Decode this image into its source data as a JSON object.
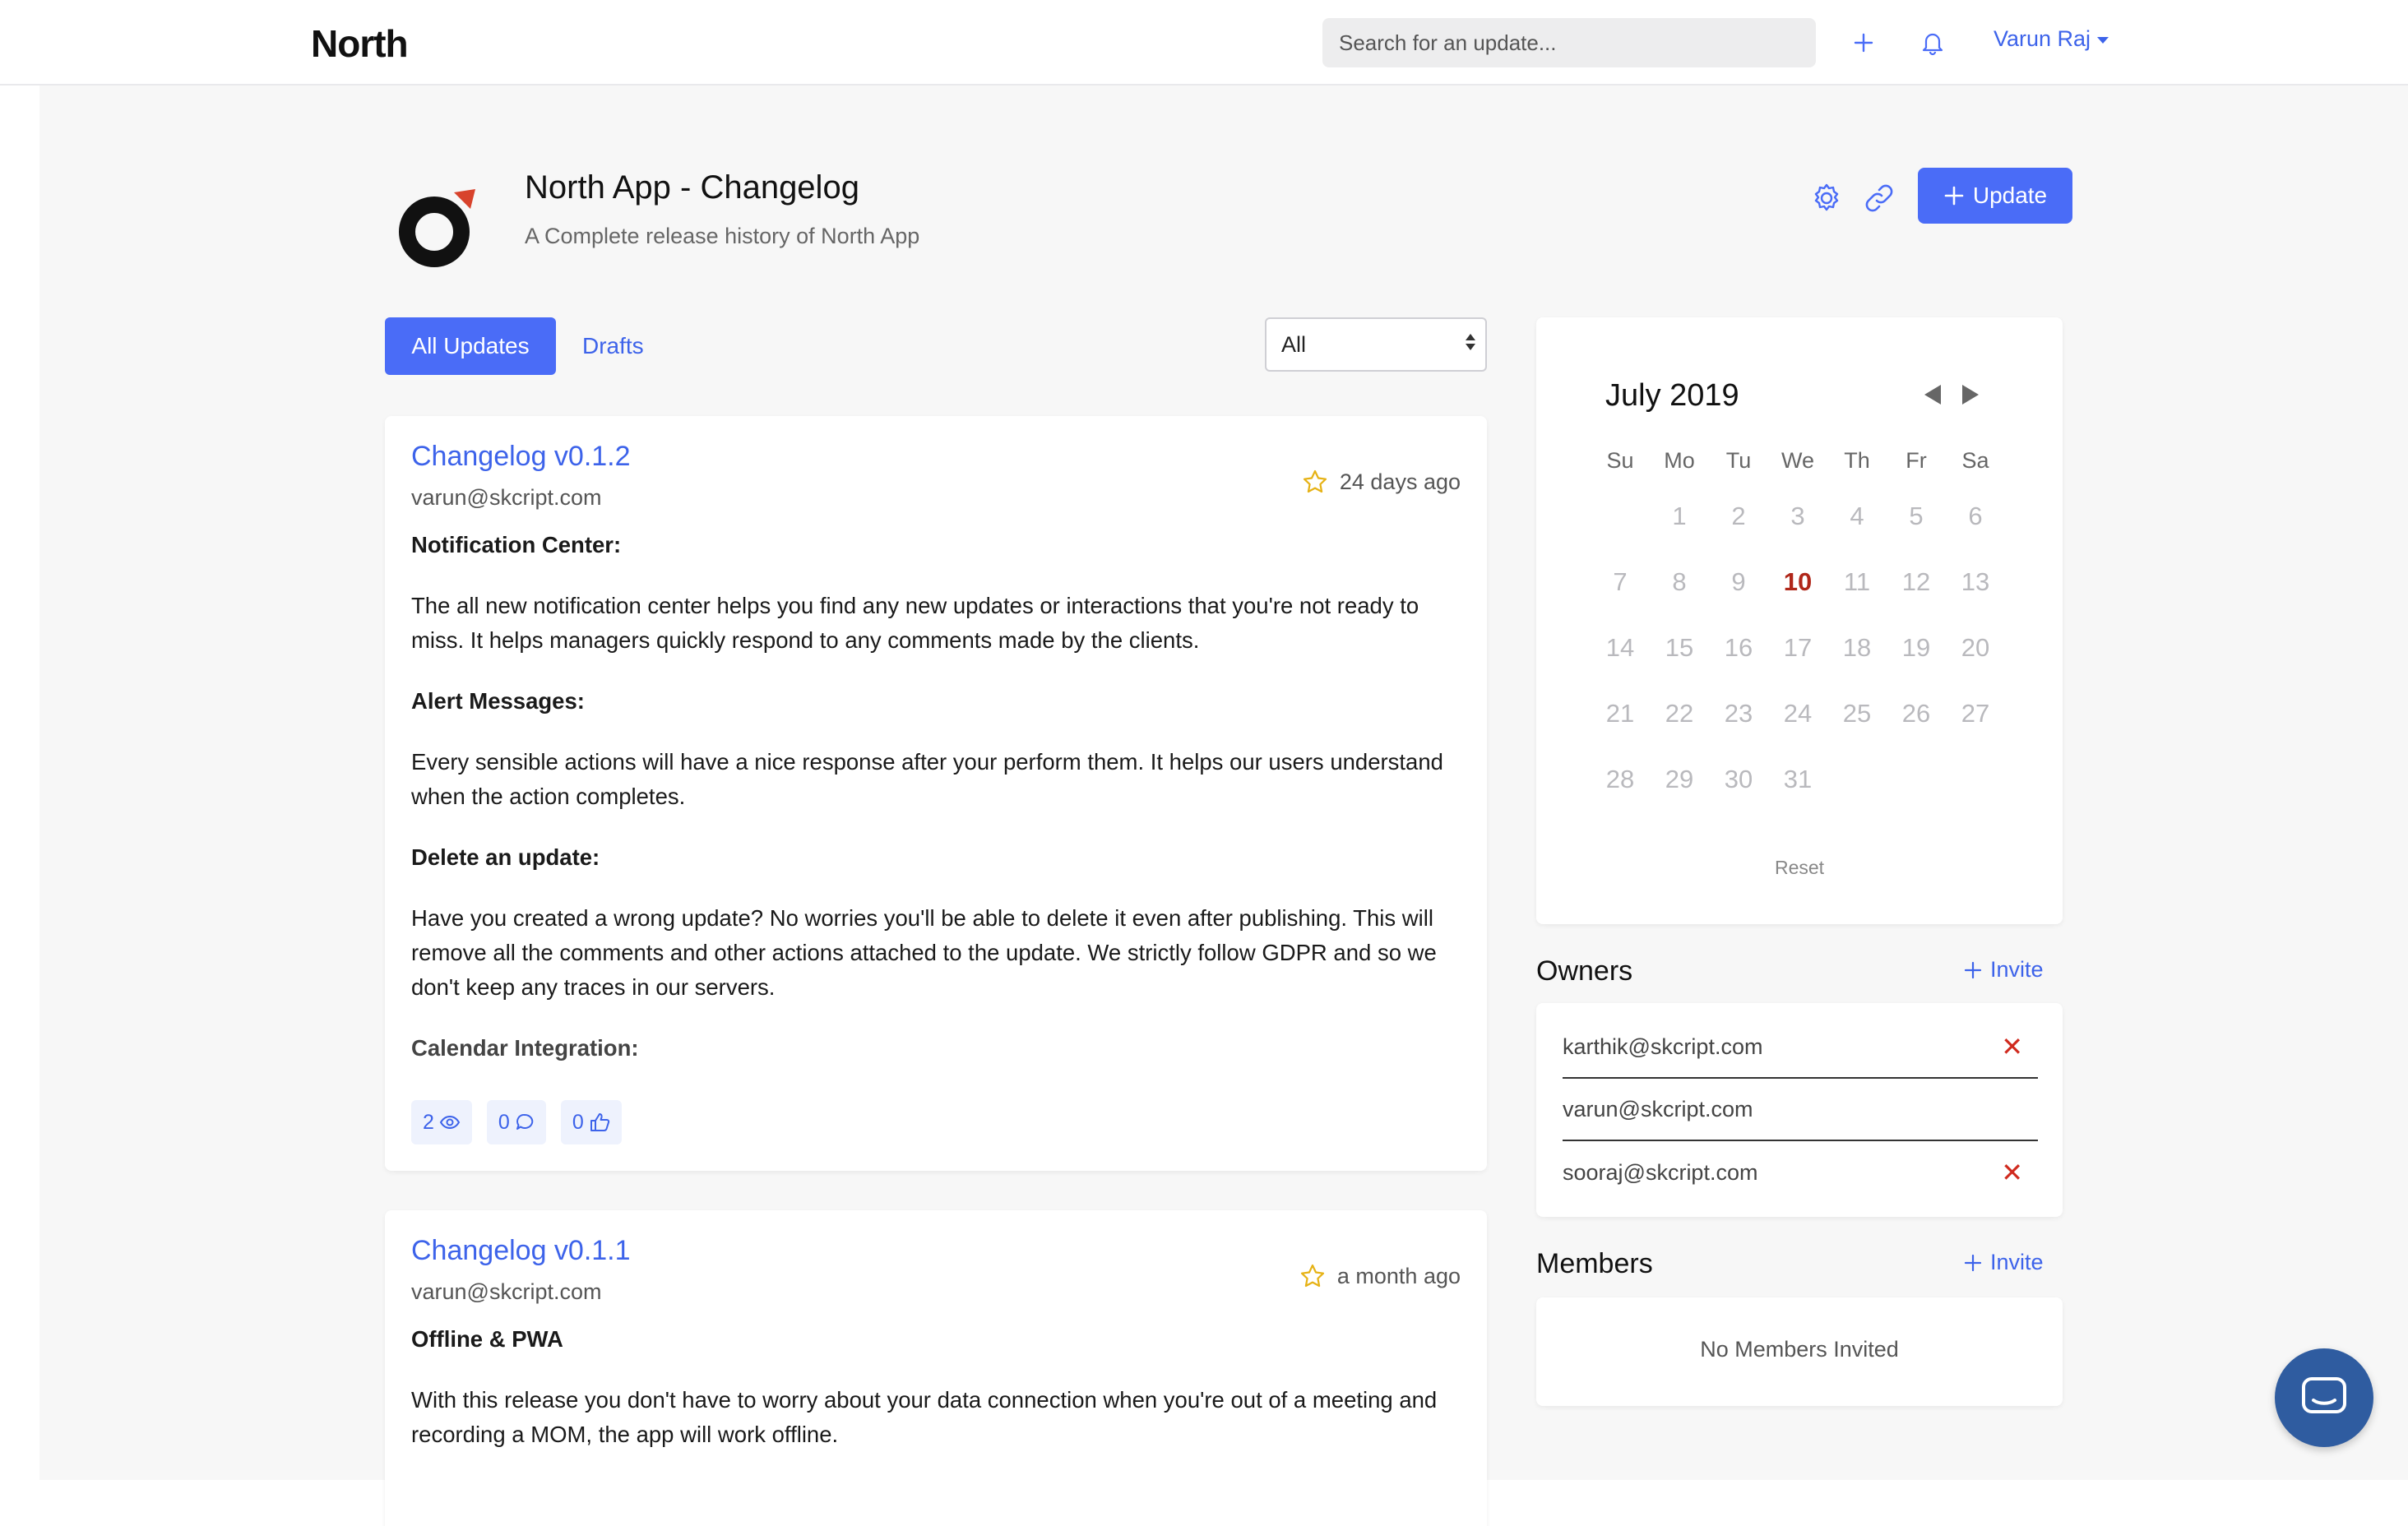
{
  "navbar": {
    "logo": "North",
    "search_placeholder": "Search for an update...",
    "user_name": "Varun Raj",
    "accent": "#4a6cf7"
  },
  "project": {
    "title": "North App - Changelog",
    "subtitle": "A Complete release history of North App",
    "update_button": "Update"
  },
  "tabs": [
    {
      "label": "All Updates",
      "active": true
    },
    {
      "label": "Drafts",
      "active": false
    }
  ],
  "filter": {
    "selected": "All"
  },
  "posts": [
    {
      "title": "Changelog v0.1.2",
      "author": "varun@skcript.com",
      "time": "24 days ago",
      "blocks": [
        {
          "type": "h",
          "text": "Notification Center:"
        },
        {
          "type": "p",
          "text": "The all new notification center helps you find any new updates or interactions that you're not ready to miss. It helps managers quickly respond to any comments made by the clients."
        },
        {
          "type": "h",
          "text": "Alert Messages:"
        },
        {
          "type": "p",
          "text": "Every sensible actions will have a nice response after your perform them. It helps our users understand when the action completes."
        },
        {
          "type": "h",
          "text": "Delete an update:"
        },
        {
          "type": "p",
          "text": "Have you created a wrong update? No worries you'll be able to delete it even after publishing. This will remove all the comments and other actions attached to the update. We strictly follow GDPR and so we don't keep any traces in our servers."
        },
        {
          "type": "h",
          "text": "Calendar Integration:"
        }
      ],
      "stats": {
        "views": "2",
        "comments": "0",
        "likes": "0"
      }
    },
    {
      "title": "Changelog v0.1.1",
      "author": "varun@skcript.com",
      "time": "a month ago",
      "blocks": [
        {
          "type": "h",
          "text": "Offline & PWA"
        },
        {
          "type": "p",
          "text": "With this release you don't have to worry about your data connection when you're out of a meeting and recording a MOM, the app will work offline."
        }
      ]
    }
  ],
  "calendar": {
    "month": "July 2019",
    "weekdays": [
      "Su",
      "Mo",
      "Tu",
      "We",
      "Th",
      "Fr",
      "Sa"
    ],
    "weeks": [
      [
        "",
        "1",
        "2",
        "3",
        "4",
        "5",
        "6"
      ],
      [
        "7",
        "8",
        "9",
        "10",
        "11",
        "12",
        "13"
      ],
      [
        "14",
        "15",
        "16",
        "17",
        "18",
        "19",
        "20"
      ],
      [
        "21",
        "22",
        "23",
        "24",
        "25",
        "26",
        "27"
      ],
      [
        "28",
        "29",
        "30",
        "31",
        "",
        "",
        ""
      ]
    ],
    "today": "10",
    "today_color": "#b0271a",
    "reset_label": "Reset"
  },
  "owners": {
    "title": "Owners",
    "invite_label": "Invite",
    "list": [
      {
        "email": "karthik@skcript.com",
        "removable": true
      },
      {
        "email": "varun@skcript.com",
        "removable": false
      },
      {
        "email": "sooraj@skcript.com",
        "removable": true
      }
    ]
  },
  "members": {
    "title": "Members",
    "invite_label": "Invite",
    "empty_text": "No Members Invited"
  },
  "icons": [
    "plus-icon",
    "bell-icon",
    "gear-icon",
    "link-icon",
    "star-icon",
    "eye-icon",
    "comment-icon",
    "thumbs-up-icon",
    "close-icon",
    "chat-icon"
  ]
}
